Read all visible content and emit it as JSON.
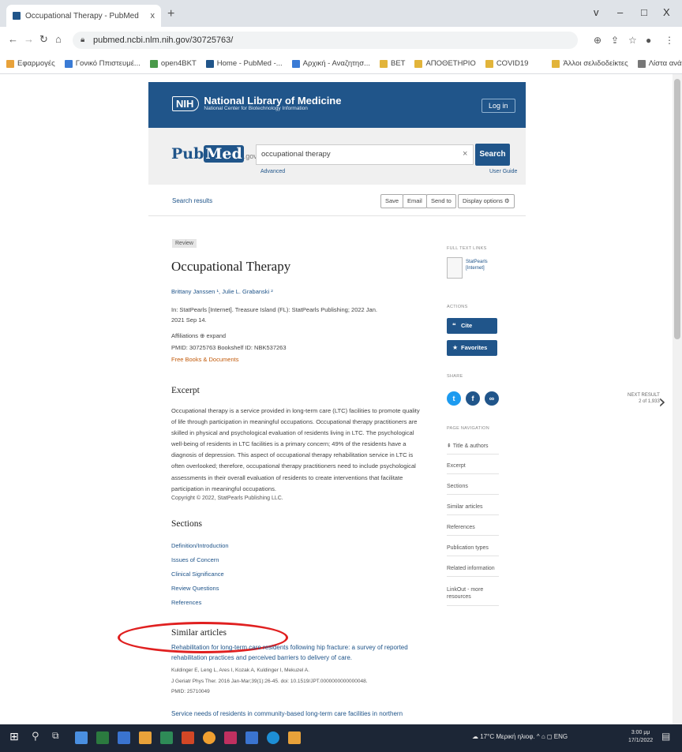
{
  "browser": {
    "tab_title": "Occupational Therapy - PubMed",
    "tab_close": "x",
    "new_tab": "+",
    "url": "pubmed.ncbi.nlm.nih.gov/30725763/",
    "window_controls": [
      "v",
      "–",
      "□",
      "X"
    ],
    "bookmarks": [
      {
        "label": "Εφαρμογές",
        "color": "#e8a23a"
      },
      {
        "label": "Γονικό Ππιστευμέ...",
        "color": "#3a7bd5"
      },
      {
        "label": "open4BKT",
        "color": "#4a9a4a"
      },
      {
        "label": "Home - PubMed -...",
        "color": "#20558a"
      },
      {
        "label": "Αρχική - Αναζητησ...",
        "color": "#3a7bd5"
      },
      {
        "label": "ΒΕΤ",
        "color": "#e2b43a"
      },
      {
        "label": "ΑΠΟΘΕΤΗΡΙΟ",
        "color": "#e2b43a"
      },
      {
        "label": "COVID19",
        "color": "#e2b43a"
      },
      {
        "label": "Άλλοι σελιδοδείκτες",
        "color": "#e2b43a"
      },
      {
        "label": "Λίστα ανάγνωσης",
        "color": "#777777"
      }
    ]
  },
  "header": {
    "nih": "NIH",
    "org_name": "National Library of Medicine",
    "org_sub": "National Center for Biotechnology Information",
    "login": "Log in"
  },
  "search": {
    "logo_pub": "Pub",
    "logo_med": "Med",
    "logo_gov": ".gov",
    "query": "occupational therapy",
    "clear": "×",
    "button": "Search",
    "advanced": "Advanced",
    "user_guide": "User Guide"
  },
  "actions": {
    "search_results": "Search results",
    "save": "Save",
    "email": "Email",
    "send_to": "Send to",
    "display_options": "Display options"
  },
  "article": {
    "badge": "Review",
    "title": "Occupational Therapy",
    "authors": "Brittany Janssen ¹, Julie L. Grabanski ²",
    "source_line1": "In: StatPearls [Internet]. Treasure Island (FL): StatPearls Publishing; 2022 Jan.",
    "source_line2": "2021 Sep 14.",
    "affiliations": "Affiliations   ⊕ expand",
    "pmid": "PMID: 30725763   Bookshelf ID: NBK537263",
    "free_books": "Free Books & Documents",
    "excerpt_heading": "Excerpt",
    "excerpt": "Occupational therapy is a service provided in long-term care (LTC) facilities to promote quality of life through participation in meaningful occupations. Occupational therapy practitioners are skilled in physical and psychological evaluation of residents living in LTC. The psychological well-being of residents in LTC facilities is a primary concern; 49% of the residents have a diagnosis of depression. This aspect of occupational therapy rehabilitation service in LTC is often overlooked; therefore, occupational therapy practitioners need to include psychological assessments in their overall evaluation of residents to create interventions that facilitate participation in meaningful occupations.",
    "copyright": "Copyright © 2022, StatPearls Publishing LLC.",
    "sections_heading": "Sections",
    "sections": [
      "Definition/Introduction",
      "Issues of Concern",
      "Clinical Significance",
      "Review Questions",
      "References"
    ],
    "similar_heading": "Similar articles",
    "similar": [
      {
        "title1": "Rehabilitation for long-term care residents following hip fracture: a survey of reported",
        "title2": "rehabilitation practices and perceived barriers to delivery of care.",
        "authors": "Kuldinger E, Leng L, Ares I, Kozak A, Kuldinger I, Mekuzel A.",
        "journal": "J Geriatr Phys Ther. 2016 Jan-Mar;39(1):26-45. doi: 10.1519/JPT.0000000000000048.",
        "pmid": "PMID: 25710049"
      },
      {
        "title1": "Service needs of residents in community-based long-term care facilities in northern"
      }
    ]
  },
  "sidebar": {
    "full_text_label": "FULL TEXT LINKS",
    "full_text_link1": "StatPearls",
    "full_text_link2": "[Internet]",
    "actions_label": "ACTIONS",
    "cite": "Cite",
    "favorites": "Favorites",
    "share_label": "SHARE",
    "page_nav_label": "PAGE NAVIGATION",
    "page_nav": [
      "Title & authors",
      "Excerpt",
      "Sections",
      "Similar articles",
      "References",
      "Publication types",
      "Related information",
      "LinkOut - more resources"
    ],
    "next_result1": "NEXT RESULT",
    "next_result2": "2 of 1,933",
    "next_chevron": "›"
  },
  "taskbar": {
    "weather": "17°C  Μερική ηλιοφ.",
    "tray": "^  ⌂  ◻  ENG",
    "time": "3:00 μμ",
    "date": "17/1/2022"
  }
}
